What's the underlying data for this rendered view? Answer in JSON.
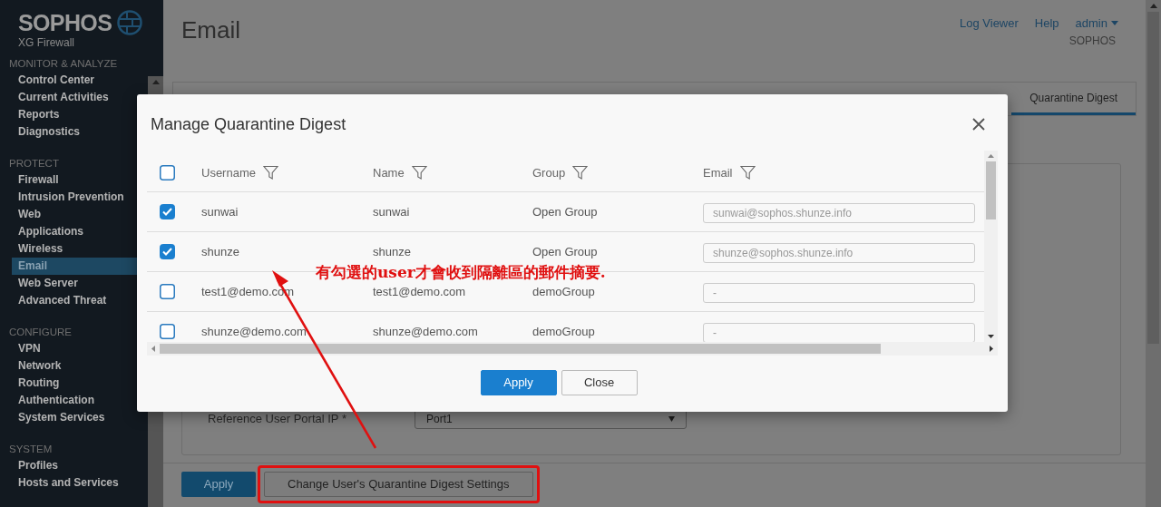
{
  "brand": {
    "name": "SOPHOS",
    "product": "XG Firewall"
  },
  "sidebar": {
    "sections": [
      {
        "title": "MONITOR & ANALYZE",
        "items": [
          {
            "label": "Control Center",
            "selected": false
          },
          {
            "label": "Current Activities",
            "selected": false
          },
          {
            "label": "Reports",
            "selected": false
          },
          {
            "label": "Diagnostics",
            "selected": false
          }
        ]
      },
      {
        "title": "PROTECT",
        "items": [
          {
            "label": "Firewall",
            "selected": false
          },
          {
            "label": "Intrusion Prevention",
            "selected": false
          },
          {
            "label": "Web",
            "selected": false
          },
          {
            "label": "Applications",
            "selected": false
          },
          {
            "label": "Wireless",
            "selected": false
          },
          {
            "label": "Email",
            "selected": true
          },
          {
            "label": "Web Server",
            "selected": false
          },
          {
            "label": "Advanced Threat",
            "selected": false
          }
        ]
      },
      {
        "title": "CONFIGURE",
        "items": [
          {
            "label": "VPN",
            "selected": false
          },
          {
            "label": "Network",
            "selected": false
          },
          {
            "label": "Routing",
            "selected": false
          },
          {
            "label": "Authentication",
            "selected": false
          },
          {
            "label": "System Services",
            "selected": false
          }
        ]
      },
      {
        "title": "SYSTEM",
        "items": [
          {
            "label": "Profiles",
            "selected": false
          },
          {
            "label": "Hosts and Services",
            "selected": false
          }
        ]
      }
    ]
  },
  "header": {
    "title": "Email",
    "links": [
      "Log Viewer",
      "Help"
    ],
    "user": "admin",
    "org": "SOPHOS"
  },
  "tabs": [
    {
      "label": "Quarantine Digest",
      "selected": true
    }
  ],
  "form": {
    "label": "Reference User Portal IP *",
    "value": "Port1"
  },
  "footer_buttons": [
    {
      "label": "Apply",
      "kind": "primary",
      "highlighted": false
    },
    {
      "label": "Change User's Quarantine Digest Settings",
      "kind": "secondary",
      "highlighted": true
    }
  ],
  "dialog": {
    "title": "Manage Quarantine Digest",
    "select_all": false,
    "columns": [
      "Username",
      "Name",
      "Group",
      "Email"
    ],
    "rows": [
      {
        "checked": true,
        "username": "sunwai",
        "name": "sunwai",
        "group": "Open Group",
        "email": "sunwai@sophos.shunze.info"
      },
      {
        "checked": true,
        "username": "shunze",
        "name": "shunze",
        "group": "Open Group",
        "email": "shunze@sophos.shunze.info"
      },
      {
        "checked": false,
        "username": "test1@demo.com",
        "name": "test1@demo.com",
        "group": "demoGroup",
        "email": "-"
      },
      {
        "checked": false,
        "username": "shunze@demo.com",
        "name": "shunze@demo.com",
        "group": "demoGroup",
        "email": "-"
      }
    ],
    "buttons": [
      {
        "label": "Apply",
        "kind": "primary"
      },
      {
        "label": "Close",
        "kind": "secondary"
      }
    ]
  },
  "annotation": {
    "text": "有勾選的user才會收到隔離區的郵件摘要."
  }
}
